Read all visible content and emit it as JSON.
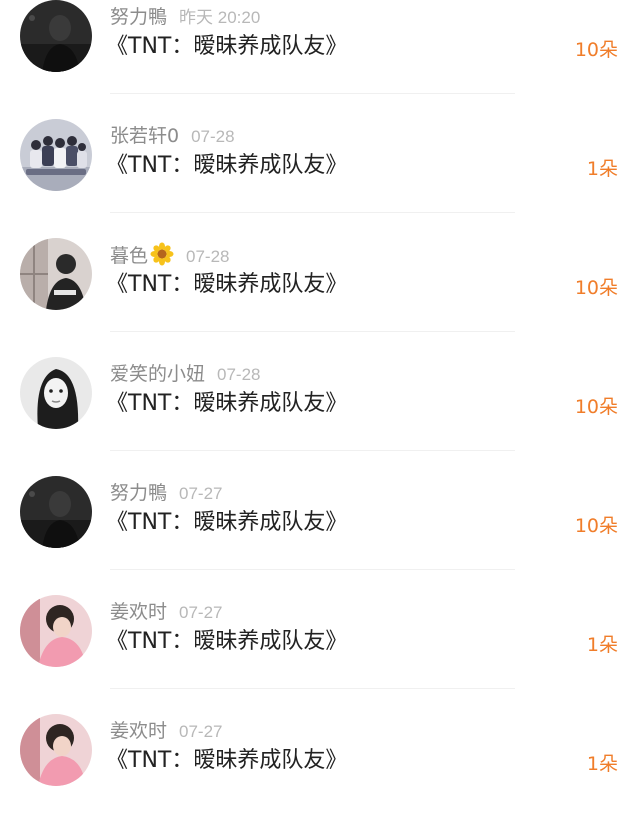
{
  "gifts": [
    {
      "name": "努力鴨",
      "date": "昨天 20:20",
      "title": "《TNT：暧昧养成队友》",
      "count": "10朵",
      "avatar": "dark-portrait-icon",
      "badge": ""
    },
    {
      "name": "张若轩0",
      "date": "07-28",
      "title": "《TNT：暧昧养成队友》",
      "count": "1朵",
      "avatar": "group-photo-icon",
      "badge": ""
    },
    {
      "name": "暮色",
      "date": "07-28",
      "title": "《TNT：暧昧养成队友》",
      "count": "10朵",
      "avatar": "window-figure-icon",
      "badge": "sunflower-icon"
    },
    {
      "name": "爱笑的小妞",
      "date": "07-28",
      "title": "《TNT：暧昧养成队友》",
      "count": "10朵",
      "avatar": "bw-portrait-icon",
      "badge": ""
    },
    {
      "name": "努力鴨",
      "date": "07-27",
      "title": "《TNT：暧昧养成队友》",
      "count": "10朵",
      "avatar": "dark-portrait-icon",
      "badge": ""
    },
    {
      "name": "姜欢时",
      "date": "07-27",
      "title": "《TNT：暧昧养成队友》",
      "count": "1朵",
      "avatar": "pink-girl-icon",
      "badge": ""
    },
    {
      "name": "姜欢时",
      "date": "07-27",
      "title": "《TNT：暧昧养成队友》",
      "count": "1朵",
      "avatar": "pink-girl-icon",
      "badge": ""
    }
  ],
  "colors": {
    "accent": "#f07d2a",
    "name": "#8c8c8c",
    "date": "#b8b8b8",
    "title": "#222222",
    "divider": "#f0f0f0"
  }
}
